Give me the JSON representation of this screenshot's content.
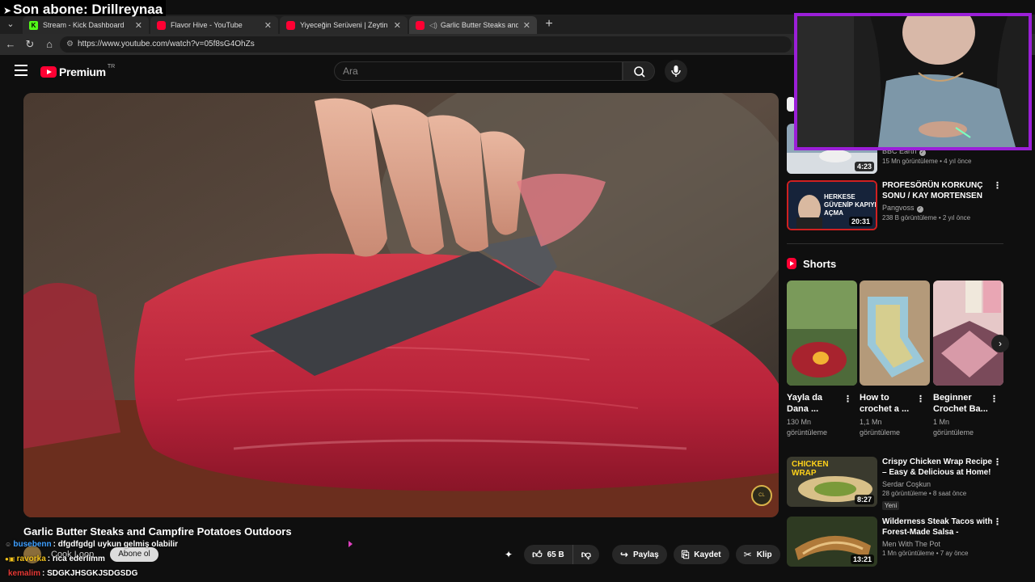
{
  "stream_overlay": {
    "last_subscriber": "Son abone: Drillreynaa"
  },
  "browser": {
    "tabs": [
      {
        "label": "Stream - Kick Dashboard",
        "favicon": "kick-icon",
        "active": false
      },
      {
        "label": "Flavor Hive - YouTube",
        "favicon": "youtube-icon",
        "active": false
      },
      {
        "label": "Yiyeceğin Serüveni | Zeytin | TRT B",
        "favicon": "youtube-icon",
        "active": false
      },
      {
        "label": "Garlic Butter Steaks and Camp",
        "favicon": "youtube-icon",
        "active": true
      }
    ],
    "url": "https://www.youtube.com/watch?v=05f8sG4OhZs"
  },
  "youtube": {
    "logo_text": "Premium",
    "country_code": "TR",
    "search_placeholder": "Ara",
    "video": {
      "title": "Garlic Butter Steaks and Campfire Potatoes Outdoors",
      "channel": "Cook Loop",
      "subscribe_label": "Abone ol",
      "likes": "65 B",
      "share_label": "Paylaş",
      "save_label": "Kaydet",
      "clip_label": "Klip"
    },
    "recommendations_top": [
      {
        "title": "",
        "channel": "BBC Earth",
        "verified": true,
        "stats": "15 Mn görüntüleme • 4 yıl önce",
        "duration": "4:23"
      },
      {
        "title": "PROFESÖRÜN KORKUNÇ SONU / KAY MORTENSEN DAVASI / ...",
        "channel": "Pangvoss",
        "verified": true,
        "stats": "238 B görüntüleme • 2 yıl önce",
        "duration": "20:31",
        "thumb_text": "HERKESE GÜVENİP KAPIYI AÇMA"
      }
    ],
    "shorts": {
      "heading": "Shorts",
      "items": [
        {
          "title": "Yayla da Dana ...",
          "views": "130 Mn görüntüleme"
        },
        {
          "title": "How to crochet a ...",
          "views": "1,1 Mn görüntüleme"
        },
        {
          "title": "Beginner Crochet Ba...",
          "views": "1 Mn görüntüleme"
        }
      ]
    },
    "recommendations_bottom": [
      {
        "title": "Crispy Chicken Wrap Recipe – Easy & Delicious at Home!",
        "channel": "Serdar Coşkun",
        "stats": "28 görüntüleme • 8 saat önce",
        "badge": "Yeni",
        "duration": "8:27",
        "thumb_text": "CHICKEN WRAP"
      },
      {
        "title": "Wilderness Steak Tacos with Forest-Made Salsa - PERFECT ...",
        "channel": "Men With The Pot",
        "stats": "1 Mn görüntüleme • 7 ay önce",
        "duration": "13:21"
      }
    ]
  },
  "chat": [
    {
      "user": "busebenn",
      "user_color": "#3fa0ff",
      "message": ": dfgdfgdgl uykun gelmiş olabilir"
    },
    {
      "user": "ravorka",
      "user_color": "#f2c21b",
      "message": ": rica ederlimm"
    },
    {
      "user": "kemalim",
      "user_color": "#e53935",
      "message": ": SDGKJHSGKJSDGSDG"
    }
  ],
  "colors": {
    "youtube_red": "#ff0033",
    "webcam_border": "#9b1fd8",
    "kick_green": "#53fc18"
  }
}
